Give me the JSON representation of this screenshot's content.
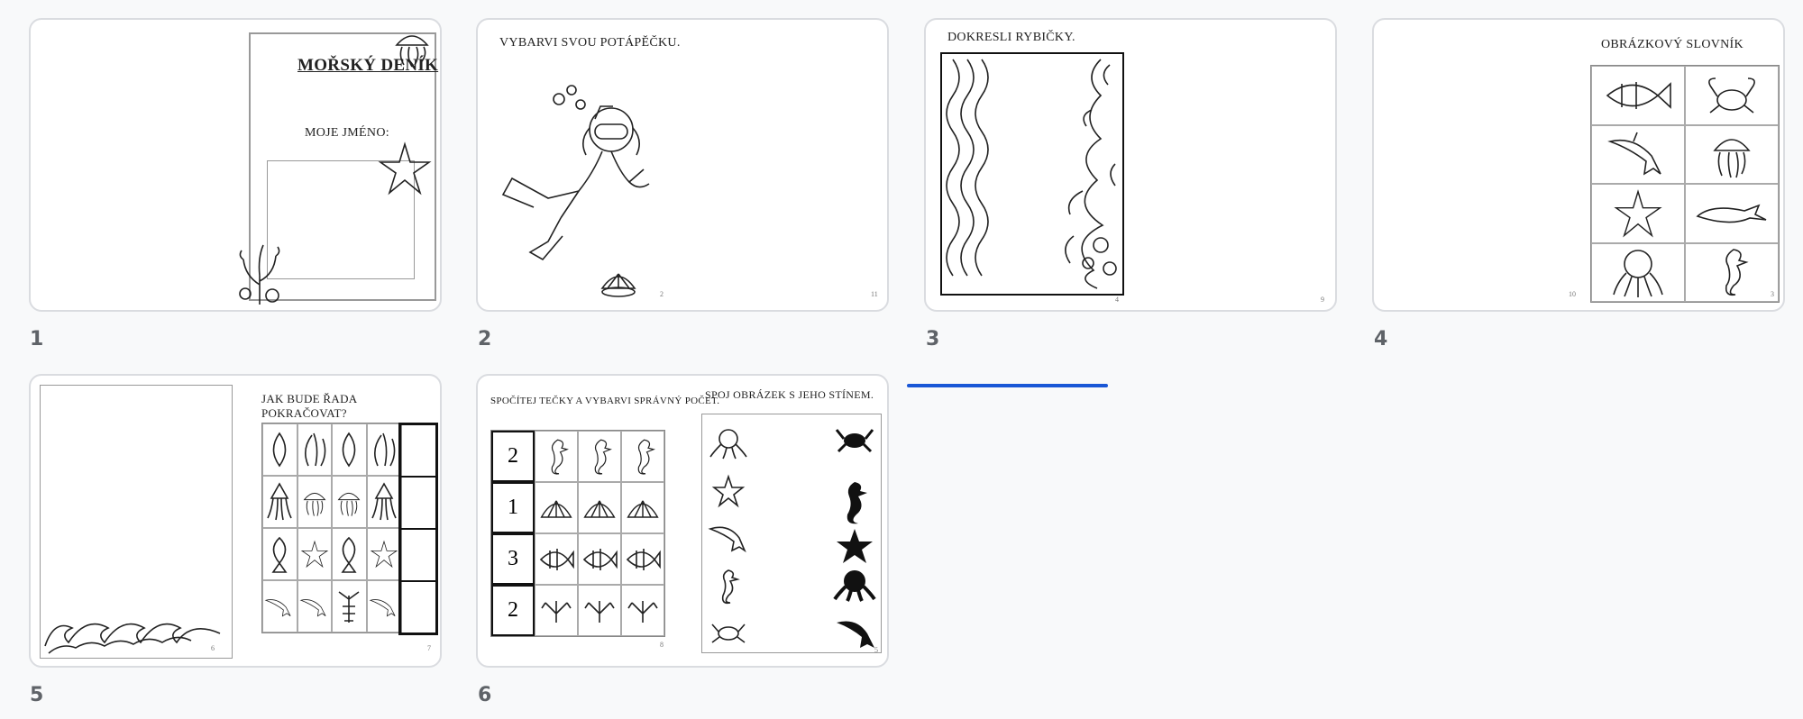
{
  "slides": [
    {
      "number": "1",
      "title": "MOŘSKÝ DENÍK",
      "subtitle": "MOJE JMÉNO:"
    },
    {
      "number": "2",
      "title": "VYBARVI SVOU POTÁPĚČKU.",
      "page_left": "2",
      "page_right": "11"
    },
    {
      "number": "3",
      "title": "DOKRESLI RYBIČKY.",
      "page_left": "4",
      "page_right": "9"
    },
    {
      "number": "4",
      "title": "OBRÁZKOVÝ SLOVNÍK",
      "page_left": "10",
      "page_right": "3"
    },
    {
      "number": "5",
      "title": "JAK BUDE ŘADA POKRAČOVAT?",
      "page_left": "6",
      "page_right": "7"
    },
    {
      "number": "6",
      "title_left": "SPOČÍTEJ TEČKY A VYBARVI SPRÁVNÝ POČET.",
      "title_right": "SPOJ OBRÁZEK S JEHO STÍNEM.",
      "counts": [
        "2",
        "1",
        "3",
        "2"
      ],
      "page_left": "8",
      "page_right": "5"
    }
  ],
  "colors": {
    "accent": "#1a57d6",
    "border": "#dadce0",
    "background": "#f8f9fa"
  }
}
